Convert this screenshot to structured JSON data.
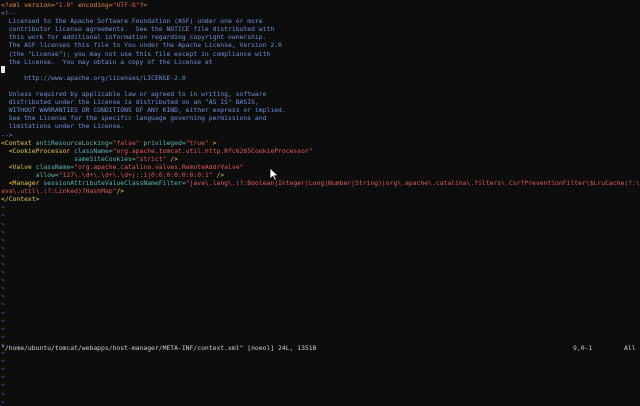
{
  "window": {
    "app": "vim"
  },
  "buffer": {
    "lines": [
      {
        "kind": "pi",
        "parts": [
          {
            "c": "c-pi",
            "t": "<?xml version="
          },
          {
            "c": "c-str",
            "t": "\"1.0\""
          },
          {
            "c": "c-pi",
            "t": " encoding="
          },
          {
            "c": "c-str",
            "t": "\"UTF-8\""
          },
          {
            "c": "c-pi",
            "t": "?>"
          }
        ]
      },
      {
        "kind": "comment",
        "parts": [
          {
            "c": "c-comment",
            "t": "<!--"
          }
        ]
      },
      {
        "kind": "comment",
        "parts": [
          {
            "c": "c-comment",
            "t": "  Licensed to the Apache Software Foundation (ASF) under one or more"
          }
        ]
      },
      {
        "kind": "comment",
        "parts": [
          {
            "c": "c-comment",
            "t": "  contributor license agreements.  See the NOTICE file distributed with"
          }
        ]
      },
      {
        "kind": "comment",
        "parts": [
          {
            "c": "c-comment",
            "t": "  this work for additional information regarding copyright ownership."
          }
        ]
      },
      {
        "kind": "comment",
        "parts": [
          {
            "c": "c-comment",
            "t": "  The ASF licenses this file to You under the Apache License, Version 2.0"
          }
        ]
      },
      {
        "kind": "comment",
        "parts": [
          {
            "c": "c-comment",
            "t": "  (the \"License\"); you may not use this file except in compliance with"
          }
        ]
      },
      {
        "kind": "comment",
        "parts": [
          {
            "c": "c-comment",
            "t": "  the License.  You may obtain a copy of the License at"
          }
        ]
      },
      {
        "kind": "cursor",
        "parts": [
          {
            "c": "c-comment",
            "t": ""
          }
        ]
      },
      {
        "kind": "comment",
        "parts": [
          {
            "c": "c-comment",
            "t": "      http://www.apache.org/licenses/LICENSE-2.0"
          }
        ]
      },
      {
        "kind": "comment",
        "parts": [
          {
            "c": "c-comment",
            "t": ""
          }
        ]
      },
      {
        "kind": "comment",
        "parts": [
          {
            "c": "c-comment",
            "t": "  Unless required by applicable law or agreed to in writing, software"
          }
        ]
      },
      {
        "kind": "comment",
        "parts": [
          {
            "c": "c-comment",
            "t": "  distributed under the License is distributed on an \"AS IS\" BASIS,"
          }
        ]
      },
      {
        "kind": "comment",
        "parts": [
          {
            "c": "c-comment",
            "t": "  WITHOUT WARRANTIES OR CONDITIONS OF ANY KIND, either express or implied."
          }
        ]
      },
      {
        "kind": "comment",
        "parts": [
          {
            "c": "c-comment",
            "t": "  See the License for the specific language governing permissions and"
          }
        ]
      },
      {
        "kind": "comment",
        "parts": [
          {
            "c": "c-comment",
            "t": "  limitations under the License."
          }
        ]
      },
      {
        "kind": "comment",
        "parts": [
          {
            "c": "c-comment",
            "t": "-->"
          }
        ]
      },
      {
        "kind": "code",
        "parts": [
          {
            "c": "c-tag",
            "t": "<Context"
          },
          {
            "c": "c-attr",
            "t": " antiResourceLocking="
          },
          {
            "c": "c-str",
            "t": "\"false\""
          },
          {
            "c": "c-attr",
            "t": " privileged="
          },
          {
            "c": "c-str",
            "t": "\"true\""
          },
          {
            "c": "c-tag",
            "t": " >"
          }
        ]
      },
      {
        "kind": "code",
        "parts": [
          {
            "c": "c-tag",
            "t": "  <CookieProcessor"
          },
          {
            "c": "c-attr",
            "t": " className="
          },
          {
            "c": "c-str",
            "t": "\"org.apache.tomcat.util.http.Rfc6265CookieProcessor\""
          }
        ]
      },
      {
        "kind": "code",
        "parts": [
          {
            "c": "c-attr",
            "t": "                   sameSiteCookies="
          },
          {
            "c": "c-str",
            "t": "\"strict\""
          },
          {
            "c": "c-tag",
            "t": " />"
          }
        ]
      },
      {
        "kind": "code",
        "parts": [
          {
            "c": "c-tag",
            "t": "  <Valve"
          },
          {
            "c": "c-attr",
            "t": " className="
          },
          {
            "c": "c-str",
            "t": "\"org.apache.catalina.valves.RemoteAddrValve\""
          }
        ]
      },
      {
        "kind": "code",
        "parts": [
          {
            "c": "c-attr",
            "t": "         allow="
          },
          {
            "c": "c-str",
            "t": "\"127\\.\\d+\\.\\d+\\.\\d+|::1|0:0:0:0:0:0:0:1\""
          },
          {
            "c": "c-tag",
            "t": " />"
          }
        ]
      },
      {
        "kind": "code",
        "parts": [
          {
            "c": "c-tag",
            "t": "  <Manager"
          },
          {
            "c": "c-attr",
            "t": " sessionAttributeValueClassNameFilter="
          },
          {
            "c": "c-str",
            "t": "\"java\\.lang\\.(?:Boolean|Integer|Long|Number|String)|org\\.apache\\.catalina\\.filters\\.CsrfPreventionFilter\\$LruCache(?:\\$1)?|j"
          }
        ]
      },
      {
        "kind": "code",
        "parts": [
          {
            "c": "c-str",
            "t": "ava\\.util\\.(?:Linked)?HashMap\""
          },
          {
            "c": "c-tag",
            "t": "/>"
          }
        ]
      },
      {
        "kind": "code",
        "parts": [
          {
            "c": "c-tag",
            "t": "</Context>"
          }
        ]
      }
    ],
    "tilde": "~",
    "tilde_count": 25
  },
  "statusline": {
    "file_info": "\"/home/ubuntu/tomcat/webapps/host-manager/META-INF/context.xml\" [noeol] 24L, 1351B",
    "position": "9,0-1",
    "scroll": "All"
  },
  "colors": {
    "background": "#0d0d0d",
    "comment": "#6b8fd6",
    "string": "#e05a5a",
    "tag": "#e8c84a",
    "attribute": "#5fb4b0",
    "processing_instruction": "#e58a3c"
  }
}
